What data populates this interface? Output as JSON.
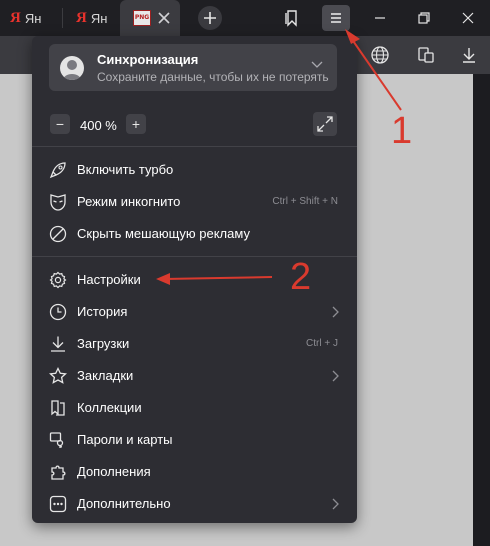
{
  "tabs": {
    "tab1_label": "Ян",
    "tab2_label": "Ян",
    "yandex_glyph": "Я",
    "png_favicon": "PNG"
  },
  "menu": {
    "sync": {
      "title": "Синхронизация",
      "subtitle": "Сохраните данные, чтобы их не потерять"
    },
    "zoom": {
      "minus": "−",
      "value": "400 %",
      "plus": "+"
    },
    "items": [
      {
        "label": "Включить турбо",
        "shortcut": ""
      },
      {
        "label": "Режим инкогнито",
        "shortcut": "Ctrl + Shift + N"
      },
      {
        "label": "Скрыть мешающую рекламу",
        "shortcut": ""
      },
      {
        "label": "Настройки",
        "shortcut": ""
      },
      {
        "label": "История",
        "shortcut": ""
      },
      {
        "label": "Загрузки",
        "shortcut": "Ctrl + J"
      },
      {
        "label": "Закладки",
        "shortcut": ""
      },
      {
        "label": "Коллекции",
        "shortcut": ""
      },
      {
        "label": "Пароли и карты",
        "shortcut": ""
      },
      {
        "label": "Дополнения",
        "shortcut": ""
      },
      {
        "label": "Дополнительно",
        "shortcut": ""
      }
    ]
  },
  "annotations": {
    "n1": "1",
    "n2": "2",
    "color": "#d93a2e"
  }
}
